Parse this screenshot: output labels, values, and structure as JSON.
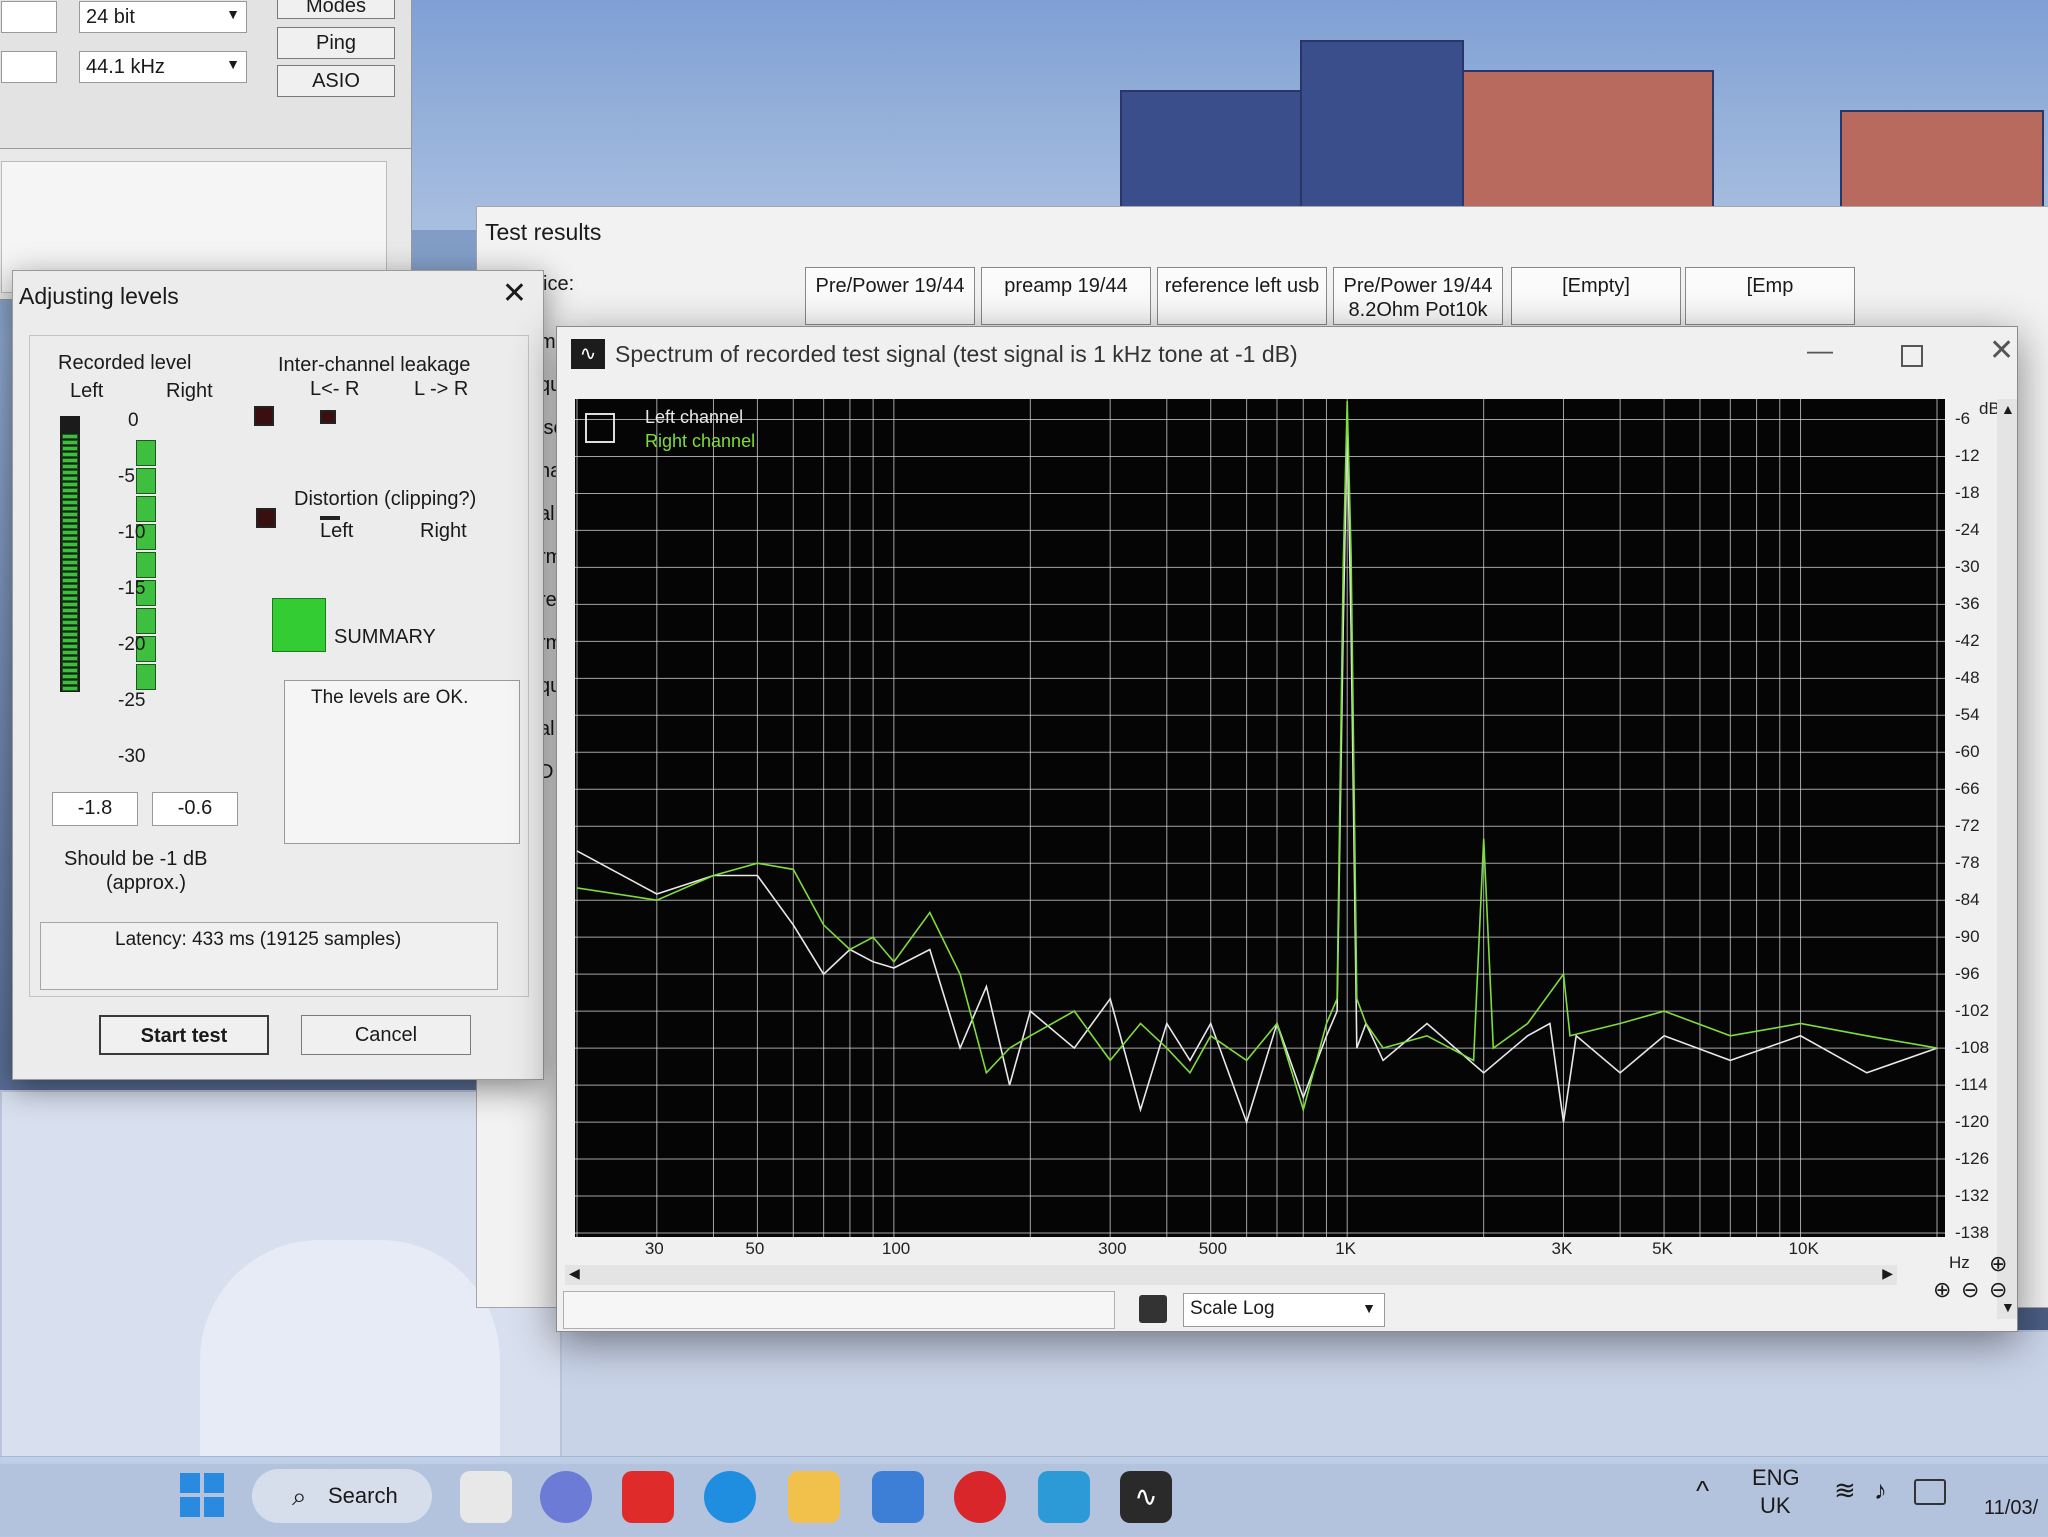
{
  "bg_window": {
    "bit_depth": "24 bit",
    "sample_rate": "44.1 kHz",
    "buttons": {
      "modes": "Modes",
      "ping": "Ping",
      "asio": "ASIO"
    }
  },
  "results": {
    "title": "Test results",
    "device_label": "vice:",
    "side_labels": [
      "mp",
      "qu",
      "ise",
      "ha",
      "al",
      "rm",
      "re",
      "rm",
      "qu",
      "al",
      "D"
    ],
    "tabs": [
      {
        "line1": "Pre/Power 19/44",
        "line2": ""
      },
      {
        "line1": "preamp 19/44",
        "line2": ""
      },
      {
        "line1": "reference left usb",
        "line2": ""
      },
      {
        "line1": "Pre/Power 19/44",
        "line2": "8.2Ohm Pot10k"
      },
      {
        "line1": "[Empty]",
        "line2": ""
      },
      {
        "line1": "[Emp",
        "line2": ""
      }
    ]
  },
  "adjust": {
    "title": "Adjusting levels",
    "recorded_level": "Recorded level",
    "left": "Left",
    "right": "Right",
    "scale": [
      "0",
      "-5",
      "-10",
      "-15",
      "-20",
      "-25",
      "-30"
    ],
    "left_value": "-1.8",
    "right_value": "-0.6",
    "should_be": "Should be -1 dB",
    "approx": "(approx.)",
    "leakage_title": "Inter-channel leakage",
    "leak_lr": "L<- R",
    "leak_rl": "L -> R",
    "distortion_title": "Distortion (clipping?)",
    "dist_left": "Left",
    "dist_right": "Right",
    "summary": "SUMMARY",
    "status_text": "The levels are OK.",
    "latency": "Latency: 433 ms (19125 samples)",
    "start_button": "Start test",
    "cancel_button": "Cancel",
    "meter_left_level": -1.8,
    "meter_right_level": -0.6
  },
  "spectrum": {
    "title": "Spectrum of recorded test signal (test signal is 1 kHz tone at -1 dB)",
    "legend_left": "Left channel",
    "legend_right": "Right channel",
    "scale_label": "Scale",
    "scale_value": "Log",
    "colors": {
      "left": "#e8e8e8",
      "right": "#7fdc3c",
      "grid": "#d8d8d8"
    }
  },
  "chart_data": {
    "type": "line",
    "title": "Spectrum of recorded test signal (test signal is 1 kHz tone at -1 dB)",
    "xlabel": "Hz",
    "ylabel": "dB",
    "x_scale": "log",
    "xlim": [
      20,
      20000
    ],
    "ylim": [
      -138,
      -3
    ],
    "x_ticks": [
      {
        "label": "30",
        "value": 30
      },
      {
        "label": "50",
        "value": 50
      },
      {
        "label": "100",
        "value": 100
      },
      {
        "label": "300",
        "value": 300
      },
      {
        "label": "500",
        "value": 500
      },
      {
        "label": "1K",
        "value": 1000
      },
      {
        "label": "3K",
        "value": 3000
      },
      {
        "label": "5K",
        "value": 5000
      },
      {
        "label": "10K",
        "value": 10000
      }
    ],
    "y_ticks": [
      "-6",
      "-12",
      "-18",
      "-24",
      "-30",
      "-36",
      "-42",
      "-48",
      "-54",
      "-60",
      "-66",
      "-72",
      "-78",
      "-84",
      "-90",
      "-96",
      "-102",
      "-108",
      "-114",
      "-120",
      "-126",
      "-132",
      "-138"
    ],
    "series": [
      {
        "name": "Left channel",
        "x": [
          20,
          30,
          40,
          50,
          60,
          70,
          80,
          90,
          100,
          120,
          140,
          160,
          180,
          200,
          250,
          300,
          350,
          400,
          450,
          500,
          600,
          700,
          800,
          900,
          950,
          980,
          1000,
          1020,
          1050,
          1100,
          1200,
          1500,
          2000,
          2500,
          2800,
          3000,
          3200,
          4000,
          5000,
          7000,
          10000,
          14000,
          20000
        ],
        "y": [
          -76,
          -83,
          -80,
          -80,
          -88,
          -96,
          -92,
          -94,
          -95,
          -92,
          -108,
          -98,
          -114,
          -102,
          -108,
          -100,
          -118,
          -104,
          -110,
          -104,
          -120,
          -104,
          -116,
          -106,
          -102,
          -40,
          -6,
          -40,
          -108,
          -104,
          -110,
          -104,
          -112,
          -106,
          -104,
          -120,
          -106,
          -112,
          -106,
          -110,
          -106,
          -112,
          -108
        ]
      },
      {
        "name": "Right channel",
        "x": [
          20,
          30,
          40,
          50,
          60,
          70,
          80,
          90,
          100,
          120,
          140,
          160,
          180,
          200,
          250,
          300,
          350,
          400,
          450,
          500,
          600,
          700,
          800,
          900,
          950,
          980,
          1000,
          1020,
          1050,
          1100,
          1200,
          1500,
          1900,
          2000,
          2100,
          2500,
          3000,
          3100,
          4000,
          5000,
          7000,
          10000,
          14000,
          20000
        ],
        "y": [
          -82,
          -84,
          -80,
          -78,
          -79,
          -88,
          -92,
          -90,
          -94,
          -86,
          -96,
          -112,
          -108,
          -106,
          -102,
          -110,
          -104,
          -108,
          -112,
          -106,
          -110,
          -104,
          -118,
          -104,
          -100,
          -30,
          -3,
          -28,
          -100,
          -104,
          -108,
          -106,
          -110,
          -74,
          -108,
          -104,
          -96,
          -106,
          -104,
          -102,
          -106,
          -104,
          -106,
          -108
        ]
      }
    ],
    "grid": true,
    "legend": "top-left"
  },
  "taskbar": {
    "search": "Search",
    "lang": "ENG",
    "region": "UK",
    "date": "11/03/"
  }
}
